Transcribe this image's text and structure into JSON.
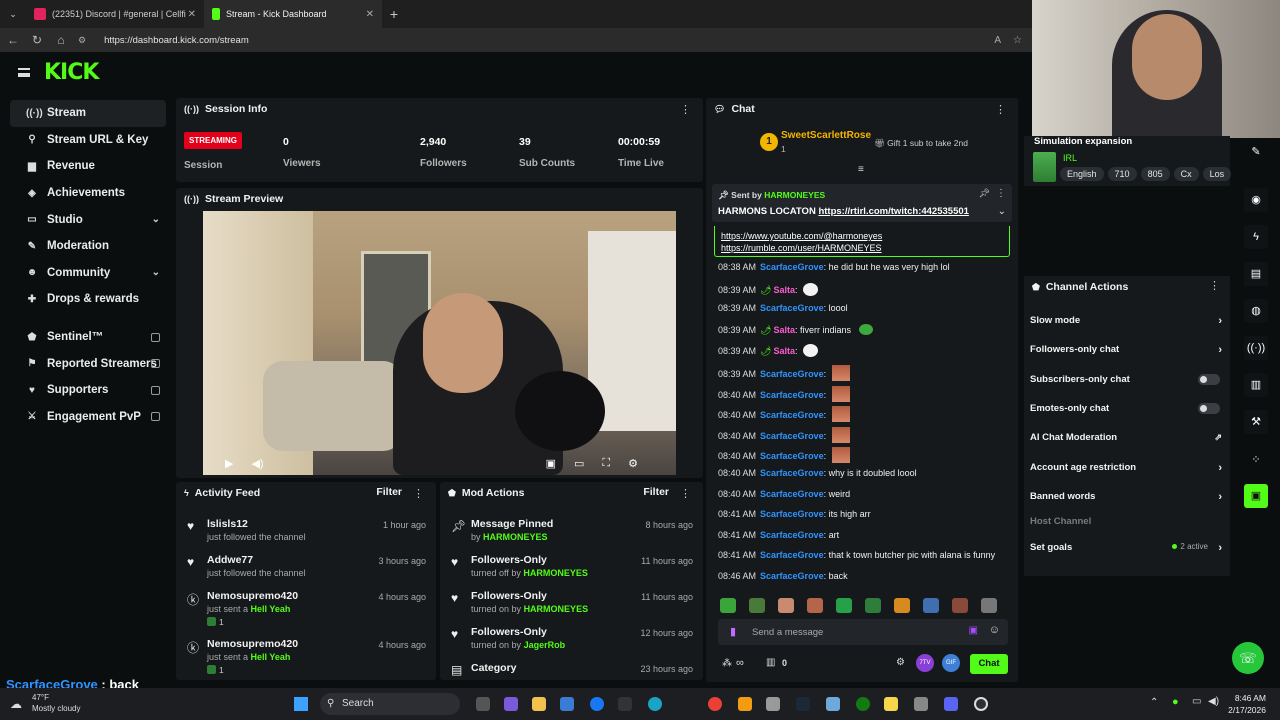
{
  "browser": {
    "tabs": [
      {
        "label": "(22351) Discord | #general | Cellfi"
      },
      {
        "label": "Stream - Kick Dashboard"
      }
    ],
    "url": "https://dashboard.kick.com/stream"
  },
  "brand": {
    "logo": "KICK",
    "accent": "#53fc18"
  },
  "sidebar": {
    "items": [
      {
        "label": "Stream",
        "icon": "broadcast-icon"
      },
      {
        "label": "Stream URL & Key",
        "icon": "key-icon"
      },
      {
        "label": "Revenue",
        "icon": "revenue-icon"
      },
      {
        "label": "Achievements",
        "icon": "achievements-icon"
      },
      {
        "label": "Studio",
        "icon": "studio-icon"
      },
      {
        "label": "Moderation",
        "icon": "hammer-icon"
      },
      {
        "label": "Community",
        "icon": "community-icon"
      },
      {
        "label": "Drops & rewards",
        "icon": "gift-icon"
      },
      {
        "label": "Sentinel™",
        "icon": "shield-icon"
      },
      {
        "label": "Reported Streamers",
        "icon": "flag-icon"
      },
      {
        "label": "Supporters",
        "icon": "heart-icon"
      },
      {
        "label": "Engagement PvP",
        "icon": "swords-icon"
      }
    ]
  },
  "session": {
    "title": "Session Info",
    "status": "STREAMING",
    "status_label": "Session",
    "viewers": "0",
    "viewers_label": "Viewers",
    "followers": "2,940",
    "followers_label": "Followers",
    "subs": "39",
    "subs_label": "Sub Counts",
    "time": "00:00:59",
    "time_label": "Time Live"
  },
  "preview": {
    "title": "Stream Preview"
  },
  "feed": {
    "title": "Activity Feed",
    "filter": "Filter",
    "items": [
      {
        "name": "lslisls12",
        "sub": "just followed the channel",
        "time": "1 hour ago"
      },
      {
        "name": "Addwe77",
        "sub": "just followed the channel",
        "time": "3 hours ago"
      },
      {
        "name": "Nemosupremo420",
        "sub": "just sent a",
        "hl": "Hell Yeah",
        "count": "1",
        "time": "4 hours ago"
      },
      {
        "name": "Nemosupremo420",
        "sub": "just sent a",
        "hl": "Hell Yeah",
        "count": "1",
        "time": "4 hours ago"
      }
    ]
  },
  "mod": {
    "title": "Mod Actions",
    "filter": "Filter",
    "items": [
      {
        "name": "Message Pinned",
        "sub": "by",
        "who": "HARMONEYES",
        "time": "8 hours ago"
      },
      {
        "name": "Followers-Only",
        "sub": "turned off by",
        "who": "HARMONEYES",
        "time": "11 hours ago"
      },
      {
        "name": "Followers-Only",
        "sub": "turned on by",
        "who": "HARMONEYES",
        "time": "11 hours ago"
      },
      {
        "name": "Followers-Only",
        "sub": "turned on by",
        "who": "JagerRob",
        "time": "12 hours ago"
      },
      {
        "name": "Category",
        "sub": "",
        "who": "",
        "time": "23 hours ago"
      }
    ]
  },
  "chat": {
    "title": "Chat",
    "top_gifter": "SweetScarlettRose",
    "top_rank": "1",
    "top_count": "1",
    "gift_text": "Gift 1 sub to take 2nd",
    "pinned_by_label": "Sent by",
    "pinned_by": "HARMONEYES",
    "pinned_msg": "HARMONS LOCATON",
    "pinned_link": "https://rtirl.com/twitch:442535501",
    "hl_lines": [
      "https://www.youtube.com/@harmoneyes",
      "https://rumble.com/user/HARMONEYES"
    ],
    "messages": [
      {
        "ts": "08:38 AM",
        "user": "ScarfaceGrove",
        "text": "he did but he was very high lol"
      },
      {
        "ts": "08:39 AM",
        "user": "Salta",
        "text": ""
      },
      {
        "ts": "08:39 AM",
        "user": "ScarfaceGrove",
        "text": "loool"
      },
      {
        "ts": "08:39 AM",
        "user": "Salta",
        "text": "fiverr indians"
      },
      {
        "ts": "08:39 AM",
        "user": "Salta",
        "text": ""
      },
      {
        "ts": "08:39 AM",
        "user": "ScarfaceGrove",
        "text": ""
      },
      {
        "ts": "08:40 AM",
        "user": "ScarfaceGrove",
        "text": ""
      },
      {
        "ts": "08:40 AM",
        "user": "ScarfaceGrove",
        "text": ""
      },
      {
        "ts": "08:40 AM",
        "user": "ScarfaceGrove",
        "text": ""
      },
      {
        "ts": "08:40 AM",
        "user": "ScarfaceGrove",
        "text": ""
      },
      {
        "ts": "08:40 AM",
        "user": "ScarfaceGrove",
        "text": "why is it doubled loool"
      },
      {
        "ts": "08:40 AM",
        "user": "ScarfaceGrove",
        "text": "weird"
      },
      {
        "ts": "08:41 AM",
        "user": "ScarfaceGrove",
        "text": "its high arr"
      },
      {
        "ts": "08:41 AM",
        "user": "ScarfaceGrove",
        "text": "art"
      },
      {
        "ts": "08:41 AM",
        "user": "ScarfaceGrove",
        "text": "that k town butcher pic with alana is funny"
      },
      {
        "ts": "08:46 AM",
        "user": "ScarfaceGrove",
        "text": "back"
      }
    ],
    "placeholder": "Send a message",
    "viewer_count": "∞",
    "gift_count": "0",
    "send": "Chat"
  },
  "stream_info": {
    "title": "Simulation expansion",
    "category": "IRL",
    "tags": [
      "English",
      "710",
      "805",
      "Cx",
      "Los"
    ]
  },
  "channel_actions": {
    "title": "Channel Actions",
    "items": [
      {
        "label": "Slow mode",
        "kind": "chevron"
      },
      {
        "label": "Followers-only chat",
        "kind": "chevron"
      },
      {
        "label": "Subscribers-only chat",
        "kind": "toggle"
      },
      {
        "label": "Emotes-only chat",
        "kind": "toggle"
      },
      {
        "label": "AI Chat Moderation",
        "kind": "external"
      },
      {
        "label": "Account age restriction",
        "kind": "chevron"
      },
      {
        "label": "Banned words",
        "kind": "chevron"
      },
      {
        "label": "Host Channel",
        "kind": "disabled"
      },
      {
        "label": "Set goals",
        "kind": "chevron",
        "extra": "2 active"
      }
    ]
  },
  "overlay": {
    "user": "ScarfaceGrove",
    "text": ": back"
  },
  "taskbar": {
    "temp": "47°F",
    "weather": "Mostly cloudy",
    "search": "Search",
    "time": "8:46 AM",
    "date": "2/17/2026"
  }
}
